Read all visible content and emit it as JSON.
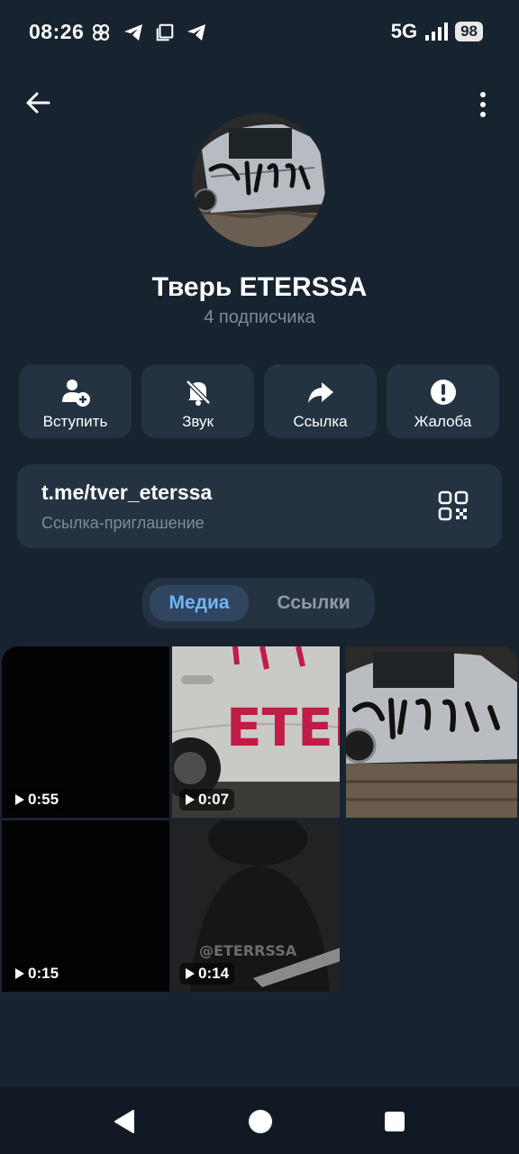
{
  "status_bar": {
    "time": "08:26",
    "network": "5G",
    "battery": "98"
  },
  "channel": {
    "name": "Тверь ETERSSA",
    "subscribers": "4 подписчика"
  },
  "actions": [
    {
      "label": "Вступить",
      "icon": "add-user-icon"
    },
    {
      "label": "Звук",
      "icon": "bell-off-icon"
    },
    {
      "label": "Ссылка",
      "icon": "share-icon"
    },
    {
      "label": "Жалоба",
      "icon": "alert-icon"
    }
  ],
  "invite_link": {
    "url": "t.me/tver_eterssa",
    "caption": "Ссылка-приглашение"
  },
  "tabs": [
    {
      "label": "Медиа",
      "active": true
    },
    {
      "label": "Ссылки",
      "active": false
    }
  ],
  "media": [
    {
      "duration": "0:55"
    },
    {
      "duration": "0:07"
    },
    {
      "duration": null
    },
    {
      "duration": "0:15"
    },
    {
      "duration": "0:14"
    }
  ],
  "watermark": "@ETERRSSA",
  "graffiti_text": "ETER",
  "colors": {
    "background": "#182330",
    "card": "#243242",
    "accent": "#6eb6f5",
    "muted": "#7f8b98"
  }
}
